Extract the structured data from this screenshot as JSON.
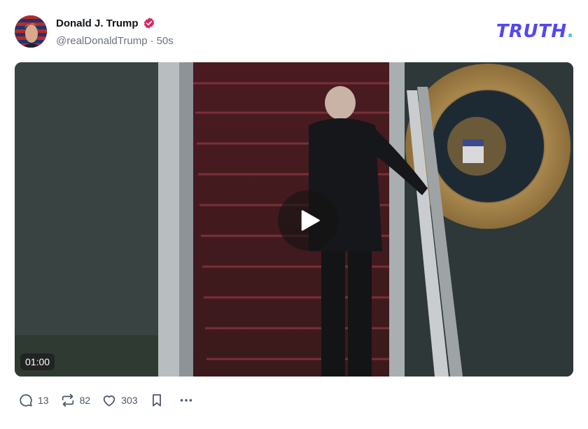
{
  "post": {
    "author": {
      "display_name": "Donald J. Trump",
      "handle": "@realDonaldTrump",
      "verified_icon": "verified-badge-icon",
      "verified_color": "#e0245e"
    },
    "timestamp": "50s",
    "separator": "·",
    "brand": {
      "text": "TRUTH",
      "dot": ".",
      "color": "#5448ee",
      "dot_color": "#3fd2c7"
    },
    "video": {
      "duration": "01:00",
      "play_icon": "play-icon"
    },
    "actions": {
      "replies": "13",
      "reposts": "82",
      "likes": "303",
      "reply_icon": "reply-icon",
      "repost_icon": "repost-icon",
      "like_icon": "heart-icon",
      "bookmark_icon": "bookmark-icon",
      "more_icon": "more-icon"
    }
  }
}
